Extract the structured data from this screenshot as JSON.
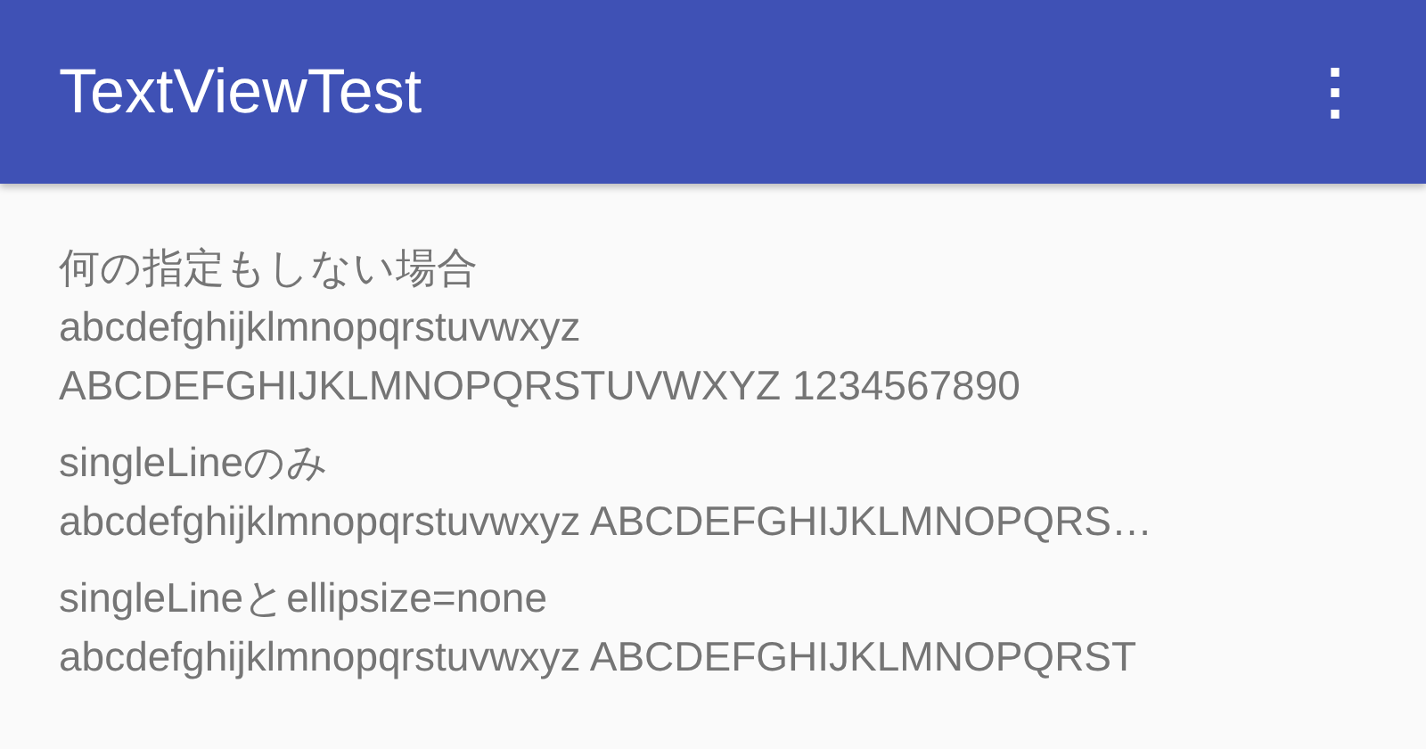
{
  "app_bar": {
    "title": "TextViewTest",
    "menu": "⋮"
  },
  "sections": [
    {
      "label": "何の指定もしない場合",
      "lines": [
        "abcdefghijklmnopqrstuvwxyz",
        "ABCDEFGHIJKLMNOPQRSTUVWXYZ 1234567890"
      ]
    },
    {
      "label": "singleLineのみ",
      "lines": [
        "abcdefghijklmnopqrstuvwxyz ABCDEFGHIJKLMNOPQRS…"
      ]
    },
    {
      "label": "singleLineとellipsize=none",
      "lines": [
        "abcdefghijklmnopqrstuvwxyz ABCDEFGHIJKLMNOPQRST"
      ]
    }
  ]
}
